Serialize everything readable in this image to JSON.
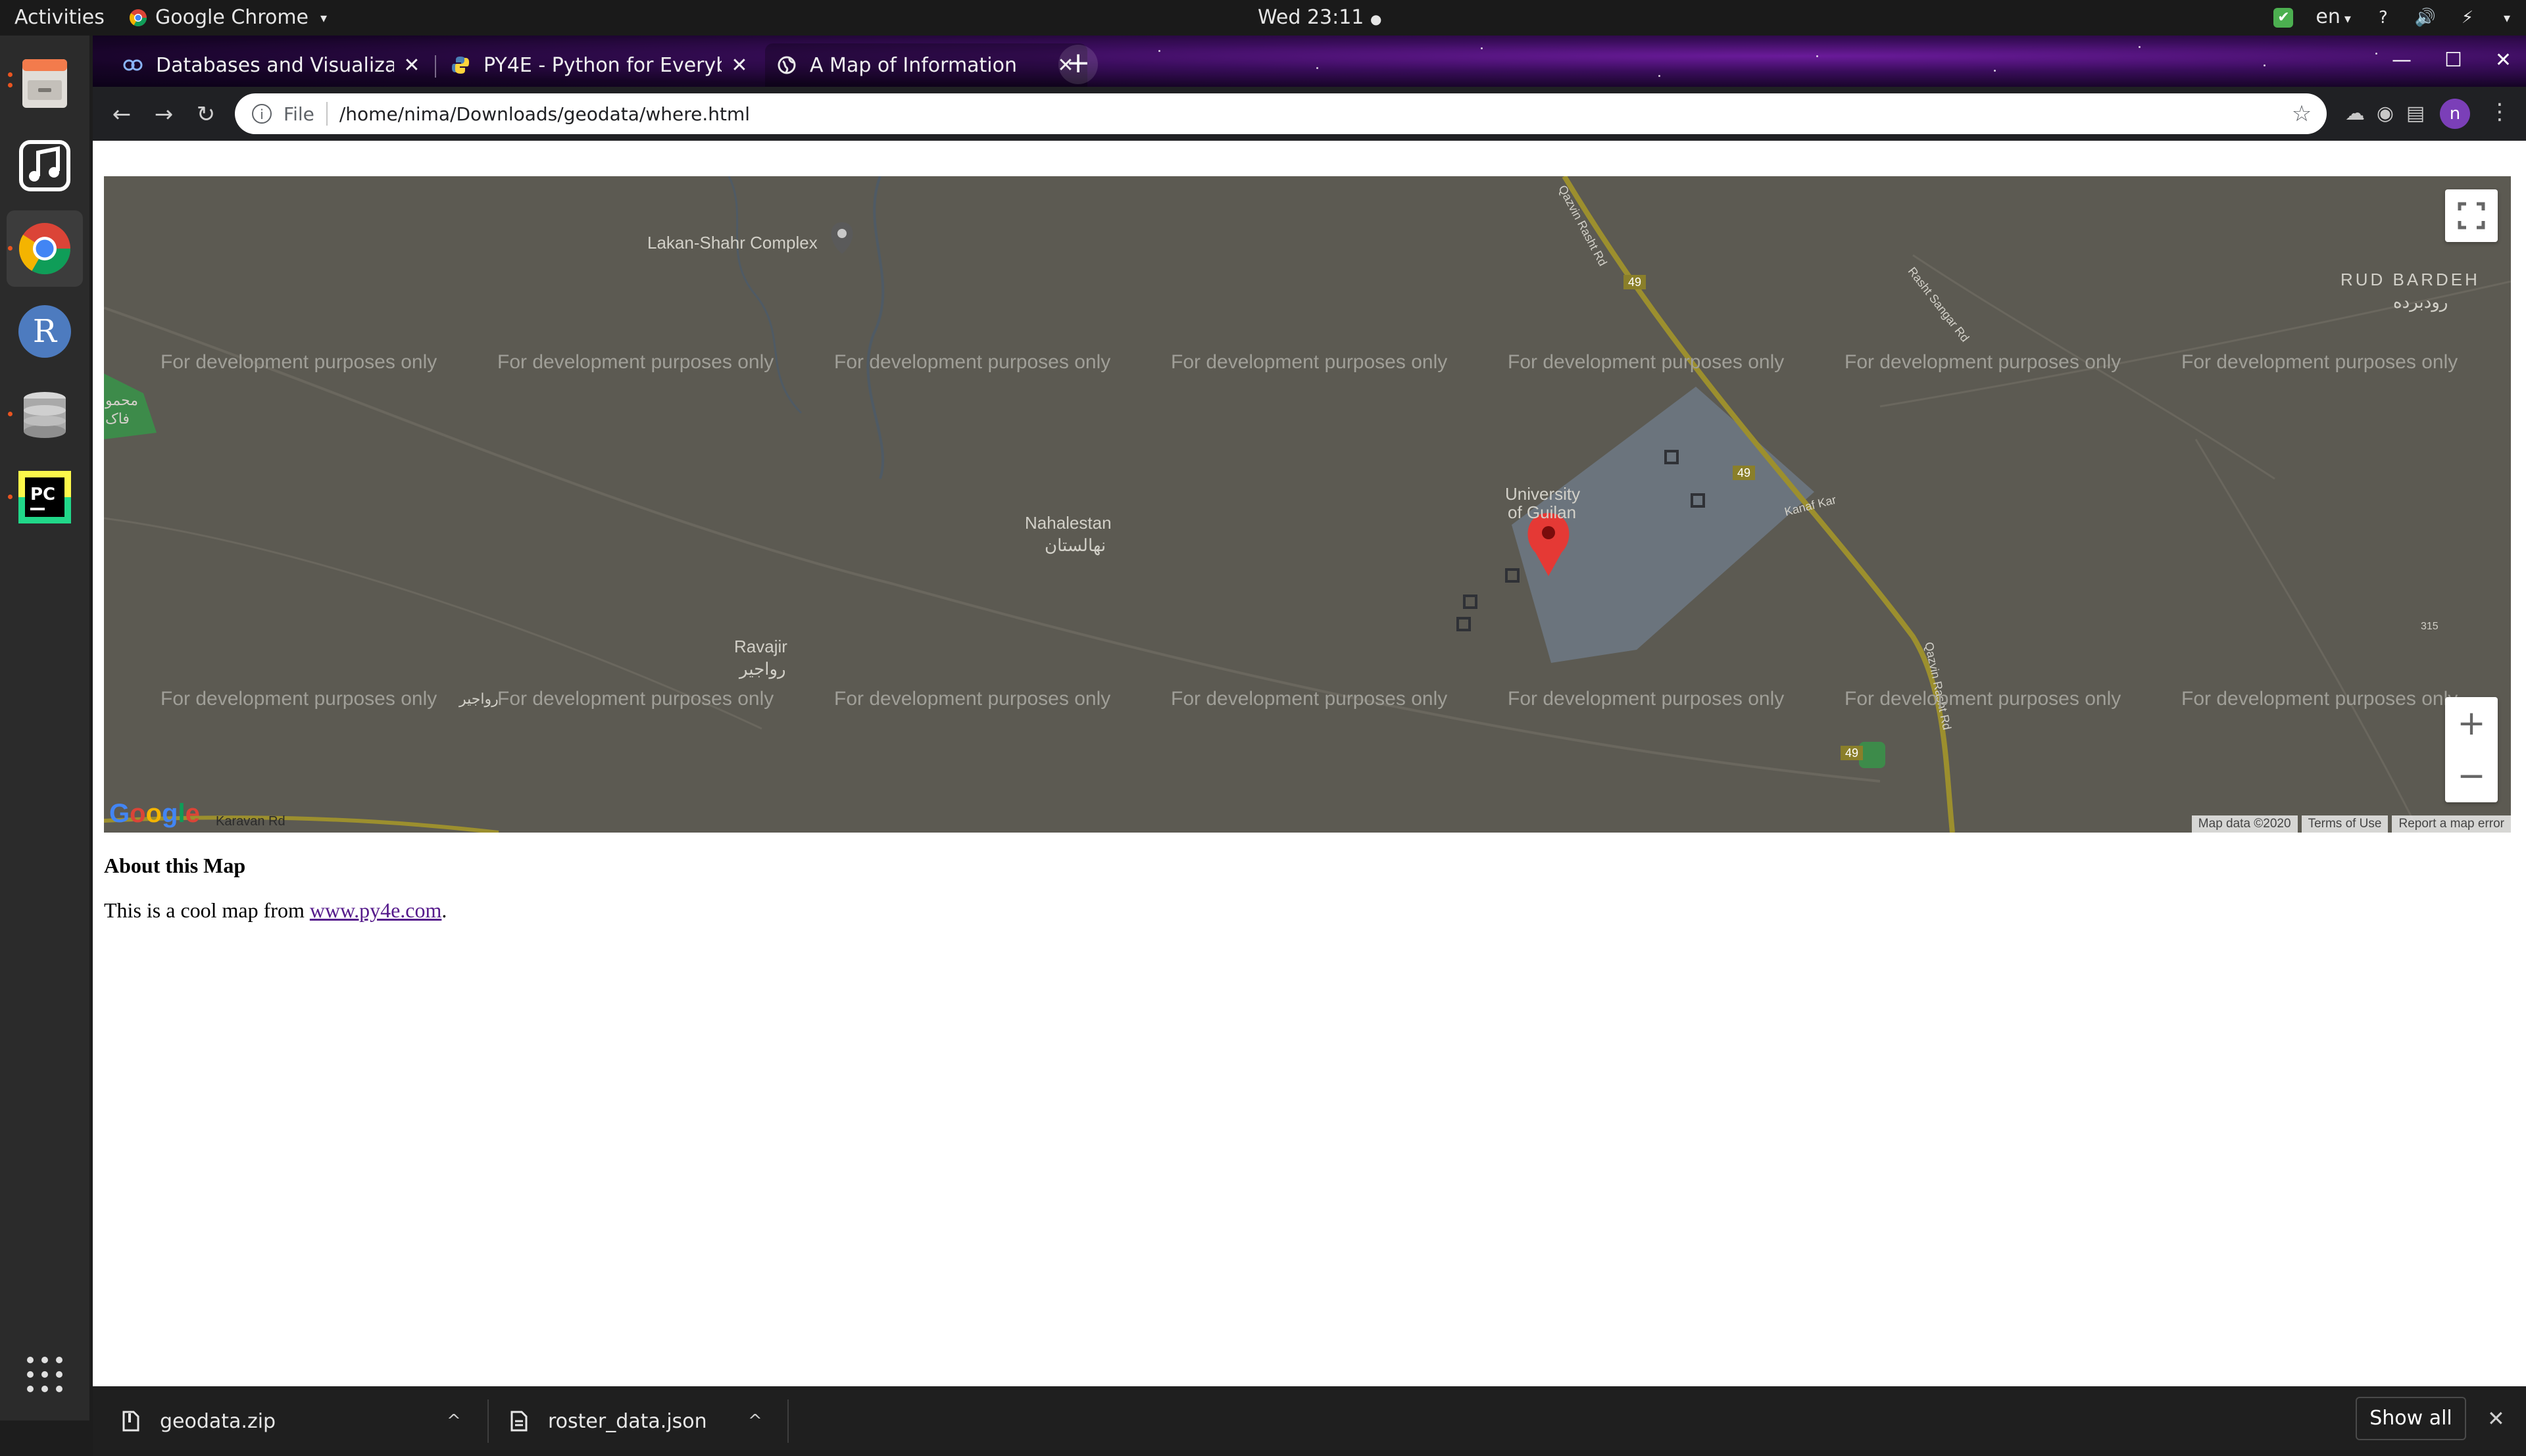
{
  "topbar": {
    "activities": "Activities",
    "app_name": "Google Chrome",
    "clock": "Wed 23:11",
    "language": "en"
  },
  "dock": {
    "apps": [
      {
        "name": "Files",
        "icon": "file-cabinet-icon"
      },
      {
        "name": "Rhythmbox",
        "icon": "music-note-icon"
      },
      {
        "name": "Google Chrome",
        "icon": "chrome-icon"
      },
      {
        "name": "R",
        "icon": "r-letter-icon"
      },
      {
        "name": "Database",
        "icon": "database-icon"
      },
      {
        "name": "PyCharm",
        "icon": "pycharm-icon"
      }
    ],
    "show_apps_icon": "grid-icon"
  },
  "tabs": [
    {
      "title": "Databases and Visualizati",
      "favicon": "coursera-icon"
    },
    {
      "title": "PY4E - Python for Everybo",
      "favicon": "python-icon"
    },
    {
      "title": "A Map of Information",
      "favicon": "globe-icon"
    }
  ],
  "toolbar": {
    "file_label": "File",
    "url": "/home/nima/Downloads/geodata/where.html",
    "profile_initial": "n"
  },
  "map": {
    "watermark": "For development purposes only",
    "places": {
      "complex": "Lakan-Shahr Complex",
      "rud_bardeh": "RUD BARDEH",
      "rud_bardeh_fa": "رودبرده",
      "nahalestan": "Nahalestan",
      "nahalestan_fa": "نهالستان",
      "university_1": "University",
      "university_2": "of Guilan",
      "ravajir": "Ravajir",
      "ravajir_fa": "رواجیر",
      "ravajir_fa_2": "رواجیر",
      "kanaf_kar": "Kanaf Kar",
      "rasht_sangar": "Rasht Sangar Rd",
      "rasht_rd": "Qazvin Rasht Rd",
      "qazvin_rasht": "Qazvin Rasht Rd",
      "left_edge_1": "محمو",
      "left_edge_2": "فاک",
      "road_sign_1": "49",
      "road_sign_315": "315",
      "karavan_rd": "Karavan Rd"
    },
    "footer": {
      "data": "Map data ©2020",
      "terms": "Terms of Use",
      "report": "Report a map error"
    },
    "logo": "Google",
    "colors": {
      "background": "#5c5a52",
      "marker": "#e53935",
      "road": "#9c8f2e",
      "campus": "#6f7a88"
    }
  },
  "about": {
    "title": "About this Map",
    "text_before": "This is a cool map from ",
    "link": "www.py4e.com",
    "text_after": "."
  },
  "downloads": {
    "items": [
      {
        "name": "geodata.zip",
        "icon": "zip-file-icon"
      },
      {
        "name": "roster_data.json",
        "icon": "document-icon"
      }
    ],
    "show_all": "Show all"
  }
}
